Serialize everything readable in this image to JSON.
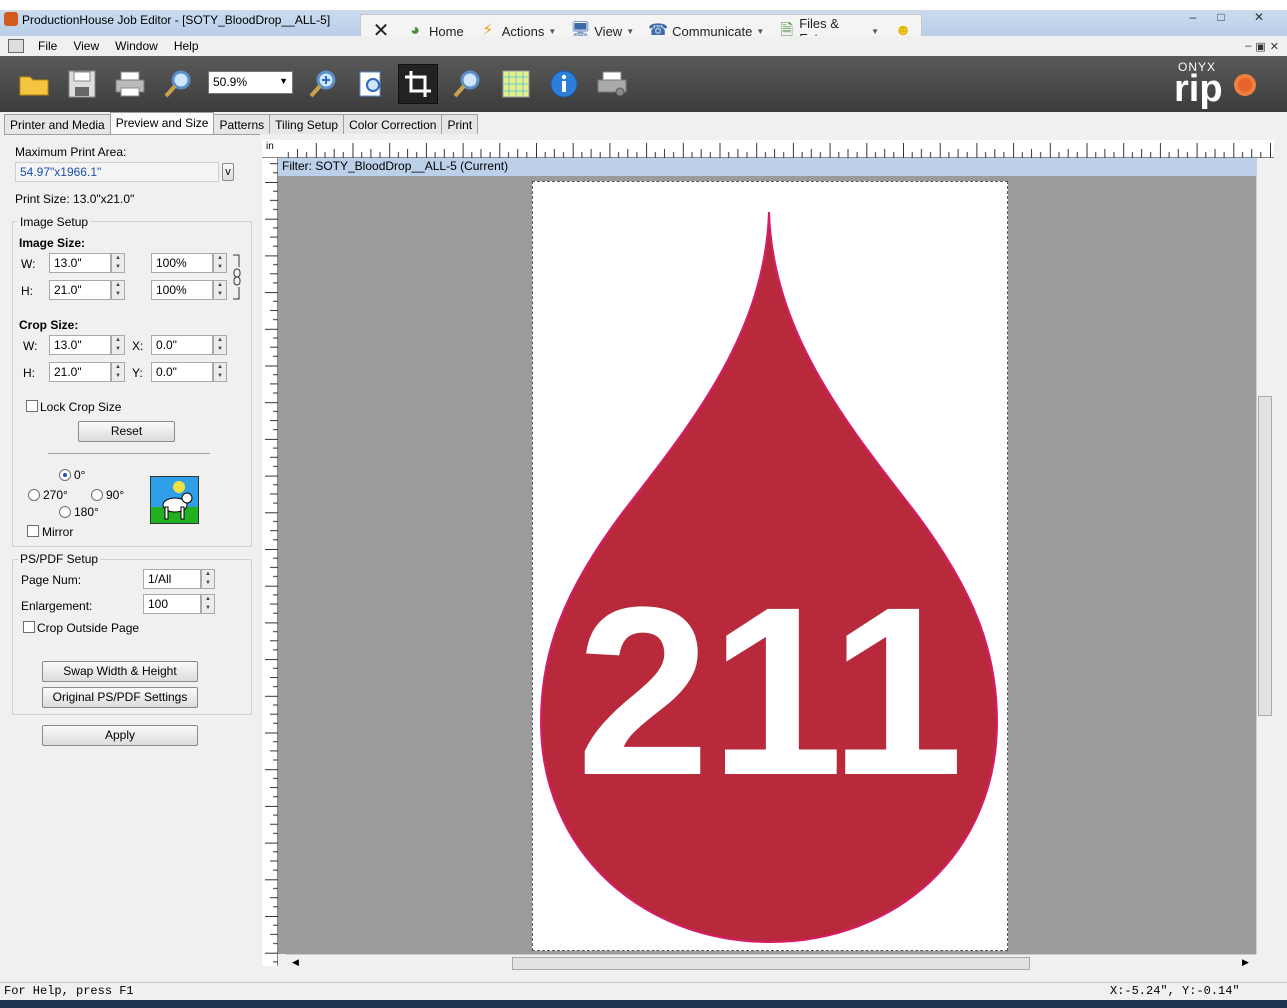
{
  "window": {
    "title": "ProductionHouse Job Editor - [SOTY_BloodDrop__ALL-5]",
    "controls": [
      "–",
      "□",
      "✕"
    ]
  },
  "remote_toolbar": {
    "close_label": "✕",
    "home": "Home",
    "actions": "Actions",
    "view": "View",
    "communicate": "Communicate",
    "files": "Files & Extras"
  },
  "menu": {
    "items": [
      "File",
      "View",
      "Window",
      "Help"
    ],
    "mdi_controls": [
      "–",
      "▣",
      "✕"
    ]
  },
  "toolbar": {
    "zoom_value": "50.9%"
  },
  "logo": {
    "onyx": "ONYX",
    "rip": "rip"
  },
  "tabs": [
    "Printer and Media",
    "Preview and Size",
    "Patterns",
    "Tiling Setup",
    "Color Correction",
    "Print"
  ],
  "left": {
    "max_print_area_label": "Maximum Print Area:",
    "max_print_area_value": "54.97\"x1966.1\"",
    "v_button": "v",
    "print_size": "Print Size: 13.0\"x21.0\"",
    "image_setup_label": "Image Setup",
    "image_size_label": "Image Size:",
    "w_label": "W:",
    "h_label": "H:",
    "img_w": "13.0\"",
    "img_h": "21.0\"",
    "img_w_pct": "100%",
    "img_h_pct": "100%",
    "crop_size_label": "Crop Size:",
    "x_label": "X:",
    "y_label": "Y:",
    "crop_w": "13.0\"",
    "crop_h": "21.0\"",
    "crop_x": "0.0\"",
    "crop_y": "0.0\"",
    "lock_crop": "Lock Crop Size",
    "reset": "Reset",
    "rot_0": "0°",
    "rot_270": "270°",
    "rot_90": "90°",
    "rot_180": "180°",
    "mirror": "Mirror",
    "ps_setup_label": "PS/PDF Setup",
    "page_num_label": "Page Num:",
    "page_num_value": "1/All",
    "enlargement_label": "Enlargement:",
    "enlargement_value": "100",
    "crop_outside": "Crop Outside Page",
    "swap": "Swap Width & Height",
    "original_ps": "Original PS/PDF Settings",
    "apply": "Apply"
  },
  "preview": {
    "ruler_unit": "in",
    "filter_text": "Filter: SOTY_BloodDrop__ALL-5 (Current)",
    "drop_number": "211",
    "drop_color": "#b82a3b",
    "drop_outline": "#d81b6a"
  },
  "status": {
    "help": "For Help, press F1",
    "coords": "X:-5.24\", Y:-0.14\""
  }
}
